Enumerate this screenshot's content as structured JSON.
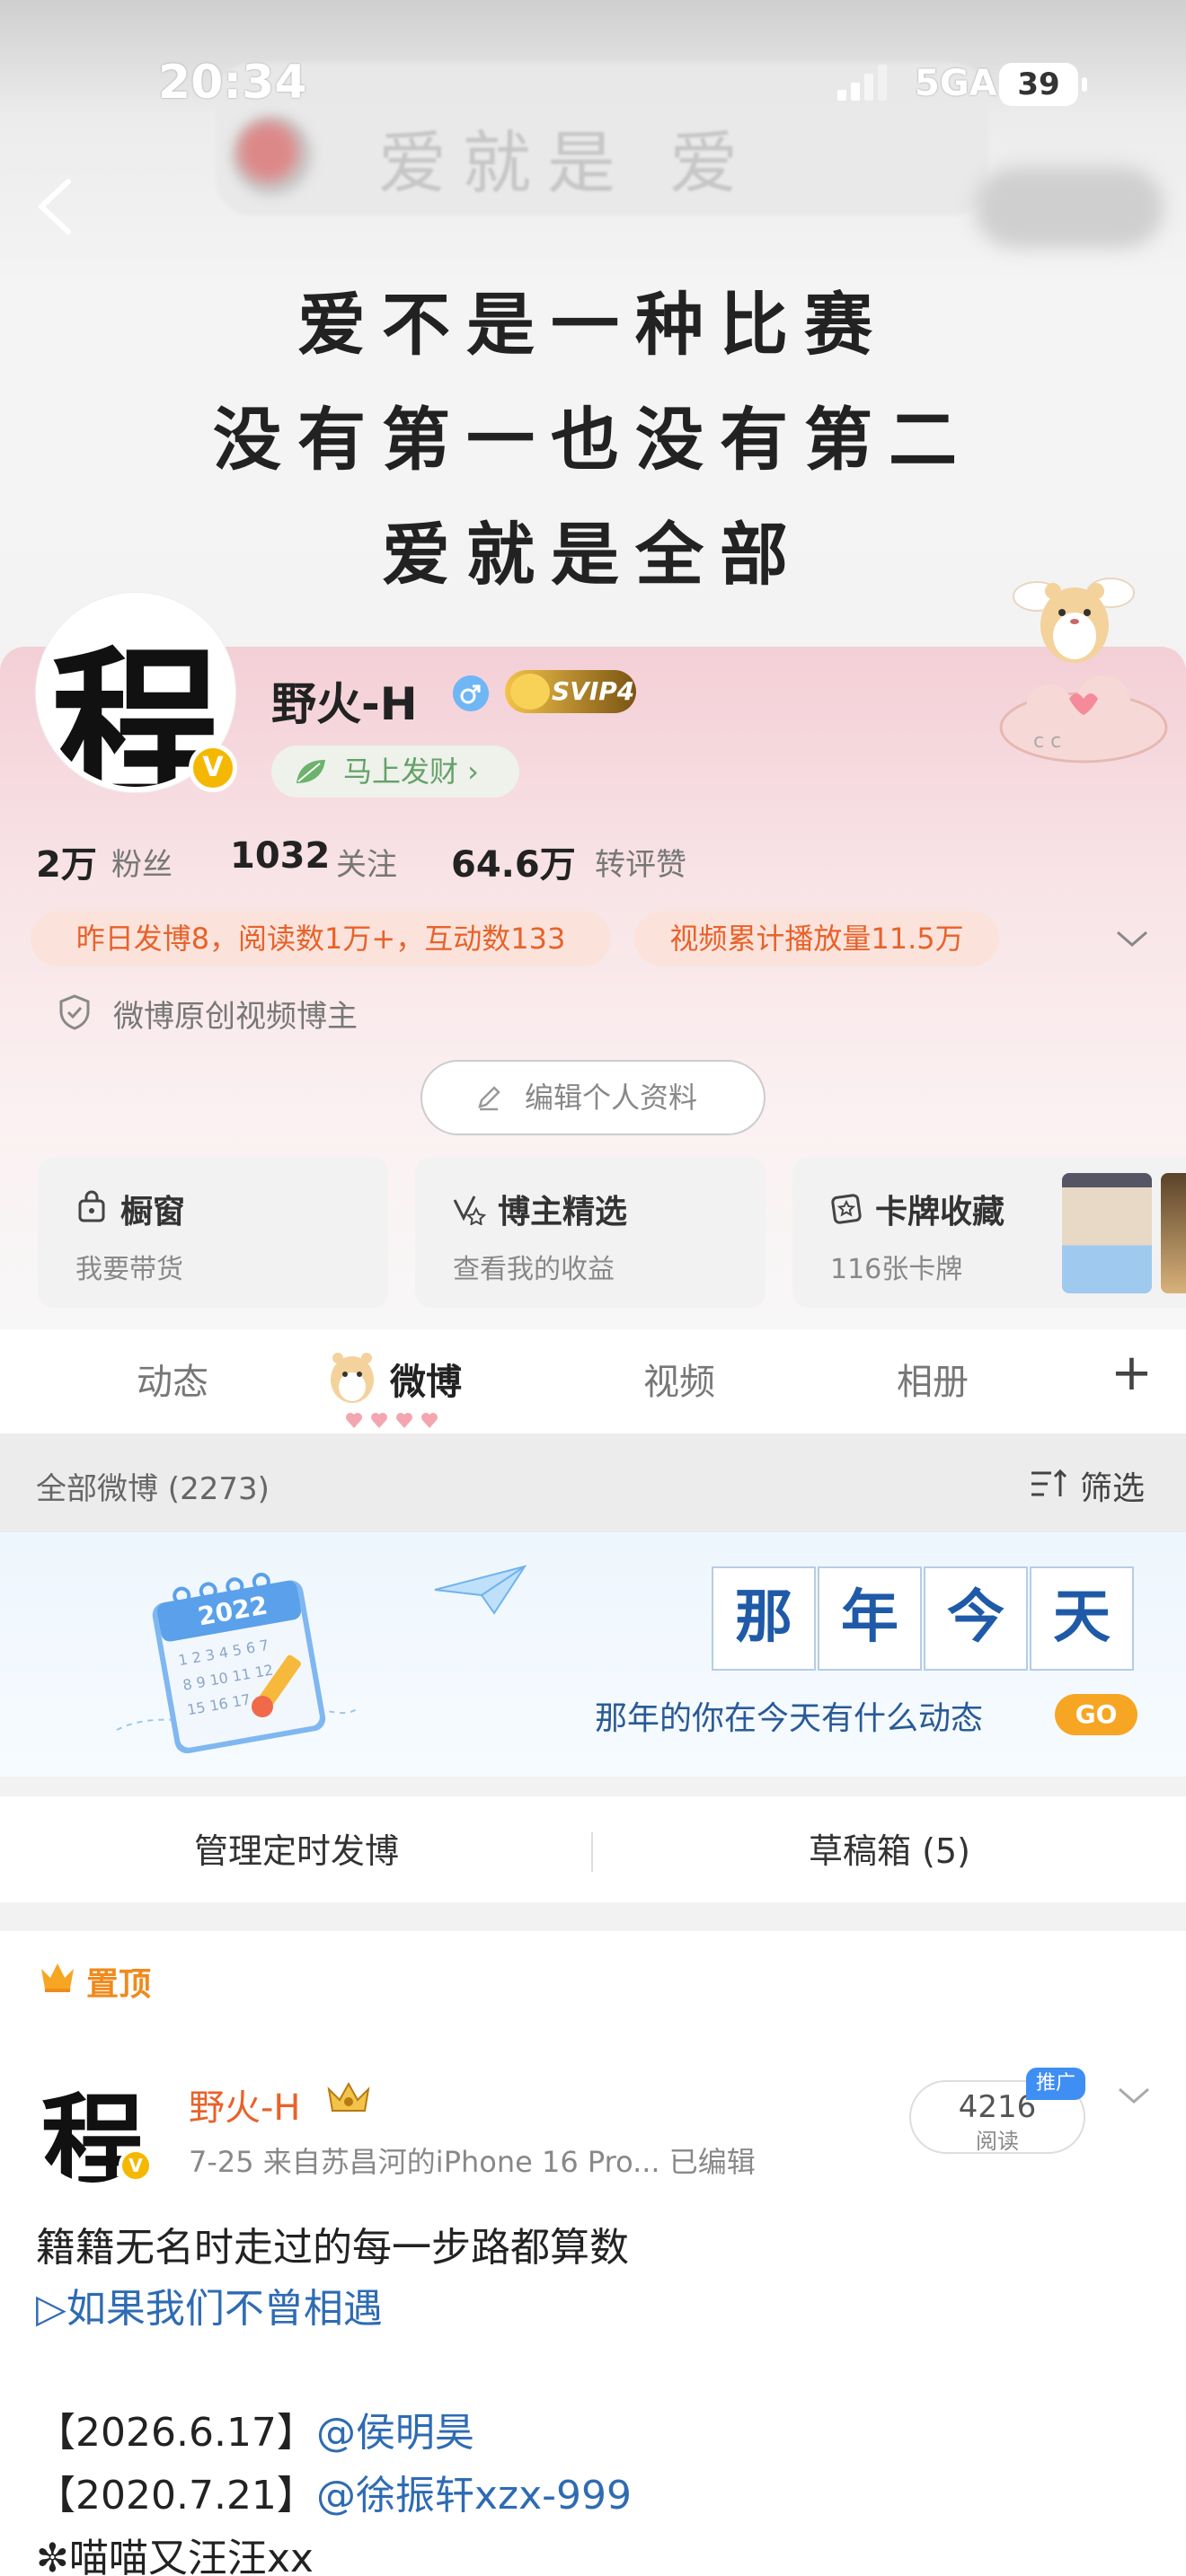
{
  "status_bar": {
    "time": "20:34",
    "network": "5GA",
    "battery": "39"
  },
  "cover": {
    "blurred_text": "爱就是 爱",
    "poem_lines": [
      "爱不是一种比赛",
      "没有第一也没有第二",
      "爱就是全部"
    ]
  },
  "profile": {
    "avatar_char": "程",
    "avatar_badge": "V",
    "username": "野火-H",
    "svip_label": "SVIP4",
    "fortune_label": "马上发财 ›",
    "stats": {
      "fans_num": "2万",
      "fans_label": "粉丝",
      "follow_num": "1032",
      "follow_label": "关注",
      "likes_num": "64.6万",
      "likes_label": "转评赞"
    },
    "tags": [
      "昨日发博8，阅读数1万+，互动数133",
      "视频累计播放量11.5万"
    ],
    "verify_text": "微博原创视频博主",
    "edit_label": "编辑个人资料"
  },
  "cards": [
    {
      "title": "橱窗",
      "sub": "我要带货",
      "icon": "shop-bag-icon"
    },
    {
      "title": "博主精选",
      "sub": "查看我的收益",
      "icon": "check-star-icon"
    },
    {
      "title": "卡牌收藏",
      "sub": "116张卡牌",
      "icon": "card-icon"
    }
  ],
  "tabs": [
    "动态",
    "微博",
    "视频",
    "相册",
    "+"
  ],
  "filter": {
    "count_label": "全部微博 (2273)",
    "filter_label": "筛选"
  },
  "banner": {
    "calendar_year": "2022",
    "grid_chars": [
      "那",
      "年",
      "今",
      "天"
    ],
    "text": "那年的你在今天有什么动态",
    "go_label": "GO"
  },
  "manage": {
    "schedule_label": "管理定时发博",
    "drafts_label": "草稿箱 (5)"
  },
  "post": {
    "pin_label": "置顶",
    "avatar_char": "程",
    "avatar_badge": "V",
    "author": "野火-H",
    "meta": "7-25  来自苏昌河的iPhone 16 Pro...  已编辑",
    "read_count": "4216",
    "read_label": "阅读",
    "promo_label": "推广",
    "lines": [
      "籍籍无名时走过的每一步路都算数",
      "▷如果我们不曾相遇"
    ],
    "line3_prefix": "【2026.6.17】",
    "line3_mention": "@侯明昊",
    "line4_prefix": "【2020.7.21】",
    "line4_mention": "@徐振轩xzx-999",
    "line5": "✼喵喵又汪汪xx"
  },
  "colors": {
    "accent_orange": "#e8622a",
    "link_blue": "#2e6bb3",
    "pink_bg": "#f3cfd6",
    "go_yellow": "#f6a623"
  }
}
